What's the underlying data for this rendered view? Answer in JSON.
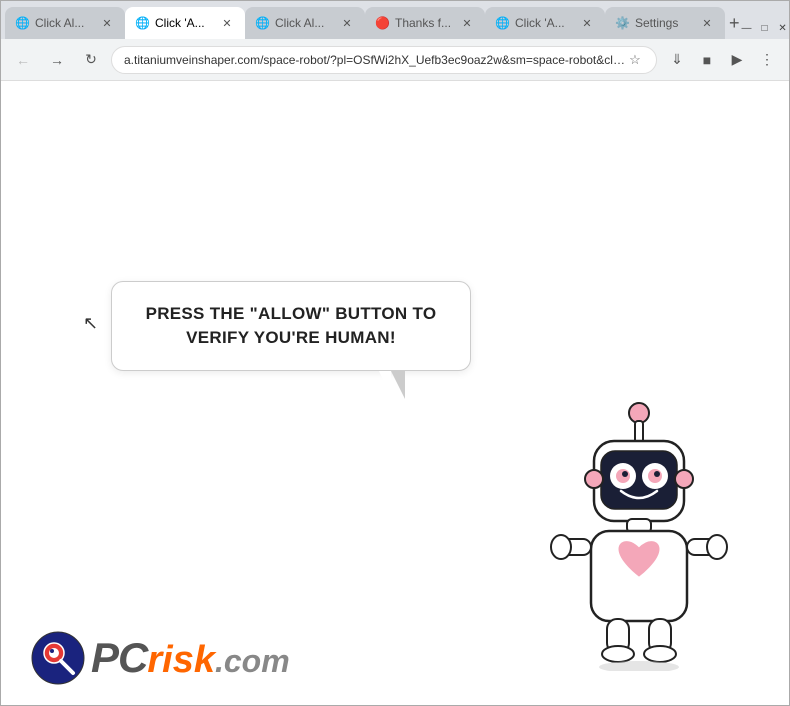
{
  "browser": {
    "tabs": [
      {
        "id": "tab1",
        "label": "Click Al...",
        "favicon": "🌐",
        "active": false
      },
      {
        "id": "tab2",
        "label": "Click 'A...",
        "favicon": "🌐",
        "active": true
      },
      {
        "id": "tab3",
        "label": "Click Al...",
        "favicon": "🌐",
        "active": false
      },
      {
        "id": "tab4",
        "label": "Thanks f...",
        "favicon": "🔴",
        "active": false
      },
      {
        "id": "tab5",
        "label": "Click 'A...",
        "favicon": "🌐",
        "active": false
      },
      {
        "id": "tab6",
        "label": "Settings",
        "favicon": "⚙️",
        "active": false
      }
    ],
    "url": "a.titaniumveinshaper.com/space-robot/?pl=OSfWi2hX_Uefb3ec9oaz2w&sm=space-robot&click_i...",
    "window_controls": {
      "minimize": "—",
      "maximize": "□",
      "close": "✕"
    }
  },
  "page": {
    "speech_bubble": {
      "text": "PRESS THE \"ALLOW\" BUTTON TO VERIFY YOU'RE HUMAN!"
    },
    "logo": {
      "prefix": "PC",
      "suffix": "risk",
      "domain": ".com"
    }
  }
}
